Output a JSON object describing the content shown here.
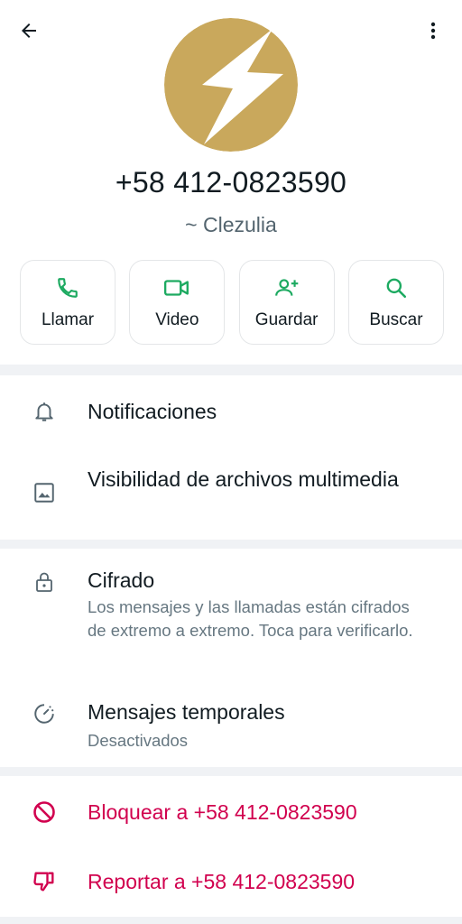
{
  "contact": {
    "phone": "+58 412-0823590",
    "alias": "~ Clezulia"
  },
  "actions": [
    {
      "label": "Llamar",
      "icon": "phone-icon"
    },
    {
      "label": "Video",
      "icon": "video-icon"
    },
    {
      "label": "Guardar",
      "icon": "add-contact-icon"
    },
    {
      "label": "Buscar",
      "icon": "search-icon"
    }
  ],
  "settings": {
    "notifications": "Notificaciones",
    "media_visibility": "Visibilidad de archivos multimedia",
    "encryption_title": "Cifrado",
    "encryption_desc": "Los mensajes y las llamadas están cifrados de extremo a extremo. Toca para verificarlo.",
    "disappearing_title": "Mensajes temporales",
    "disappearing_value": "Desactivados"
  },
  "danger": {
    "block": "Bloquear a +58 412-0823590",
    "report": "Reportar a +58 412-0823590"
  },
  "colors": {
    "accent_green": "#1daa61",
    "danger_red": "#d1004e",
    "avatar_gold": "#c9a85c"
  }
}
